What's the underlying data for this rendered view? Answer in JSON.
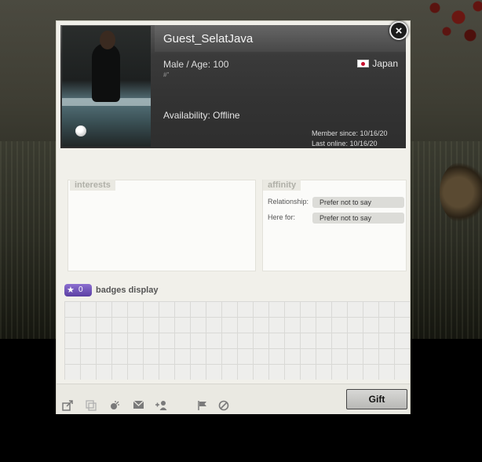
{
  "profile": {
    "username": "Guest_SelatJava",
    "gender_age": "Male   / Age: 100",
    "hash": "#\"",
    "country": "Japan",
    "availability": "Availability: Offline",
    "member_since": "Member since: 10/16/20",
    "last_online": "Last online: 10/16/20"
  },
  "interests": {
    "title": "interests"
  },
  "affinity": {
    "title": "affinity",
    "relationship_label": "Relationship:",
    "relationship_value": "Prefer not to say",
    "here_for_label": "Here for:",
    "here_for_value": "Prefer not to say"
  },
  "badges": {
    "count": "0",
    "label": "badges display"
  },
  "actions": {
    "gift_label": "Gift",
    "close_glyph": "×"
  },
  "icons": [
    "external-link-icon",
    "copy-icon",
    "gift-sparkle-icon",
    "mail-icon",
    "add-friend-icon",
    "flag-icon",
    "block-icon"
  ]
}
